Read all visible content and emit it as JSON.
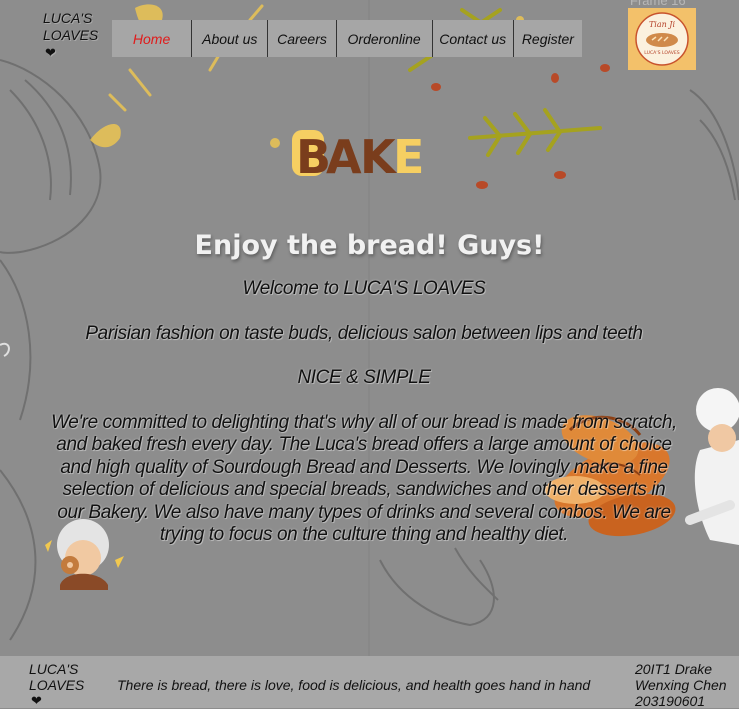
{
  "brand": {
    "line1": "LUCA'S",
    "line2": "LOAVES",
    "heart": "❤"
  },
  "nav": {
    "items": [
      {
        "label": "Home"
      },
      {
        "label": "About us"
      },
      {
        "label": "Careers"
      },
      {
        "label": "Orderonline"
      },
      {
        "label": "Contact us"
      },
      {
        "label": "Register"
      }
    ],
    "active_color": "#e01b1b"
  },
  "logo": {
    "top_text": "Tian Ji",
    "bottom_text": "LUCA'S LOAVES"
  },
  "frame_label": "Frame 16",
  "decor": {
    "bake_word": "BAKE"
  },
  "main": {
    "heading": "Enjoy the bread! Guys!",
    "welcome": "Welcome to LUCA'S LOAVES",
    "tagline": "Parisian fashion on taste buds, delicious salon between lips and teeth",
    "motto": "NICE & SIMPLE",
    "description": "We're committed to delighting that's why all of our bread is made from scratch, and baked fresh every day. The Luca's bread offers a large amount of choice and high quality of Sourdough Bread and Desserts. We lovingly make a fine selection of delicious and special breads, sandwiches and other desserts in our Bakery. We also have many types of drinks and several combos. We are trying to focus on the culture thing and healthy diet."
  },
  "footer": {
    "brand_line1": "LUCA'S",
    "brand_line2": "LOAVES",
    "heart": "❤",
    "slogan": "There is bread, there is love, food is delicious, and health goes hand in hand",
    "credit_line1": "20IT1 Drake",
    "credit_line2": "Wenxing Chen",
    "credit_line3": "203190601"
  },
  "colors": {
    "background": "#8d8d8d",
    "nav_bg": "#a6a6a6",
    "footer_bg": "#a8a8a8",
    "logo_bg": "#f3c16a",
    "bake_brown": "#7a3d1c",
    "bake_yellow": "#f6cf62",
    "accent_olive": "#a5a21f"
  }
}
